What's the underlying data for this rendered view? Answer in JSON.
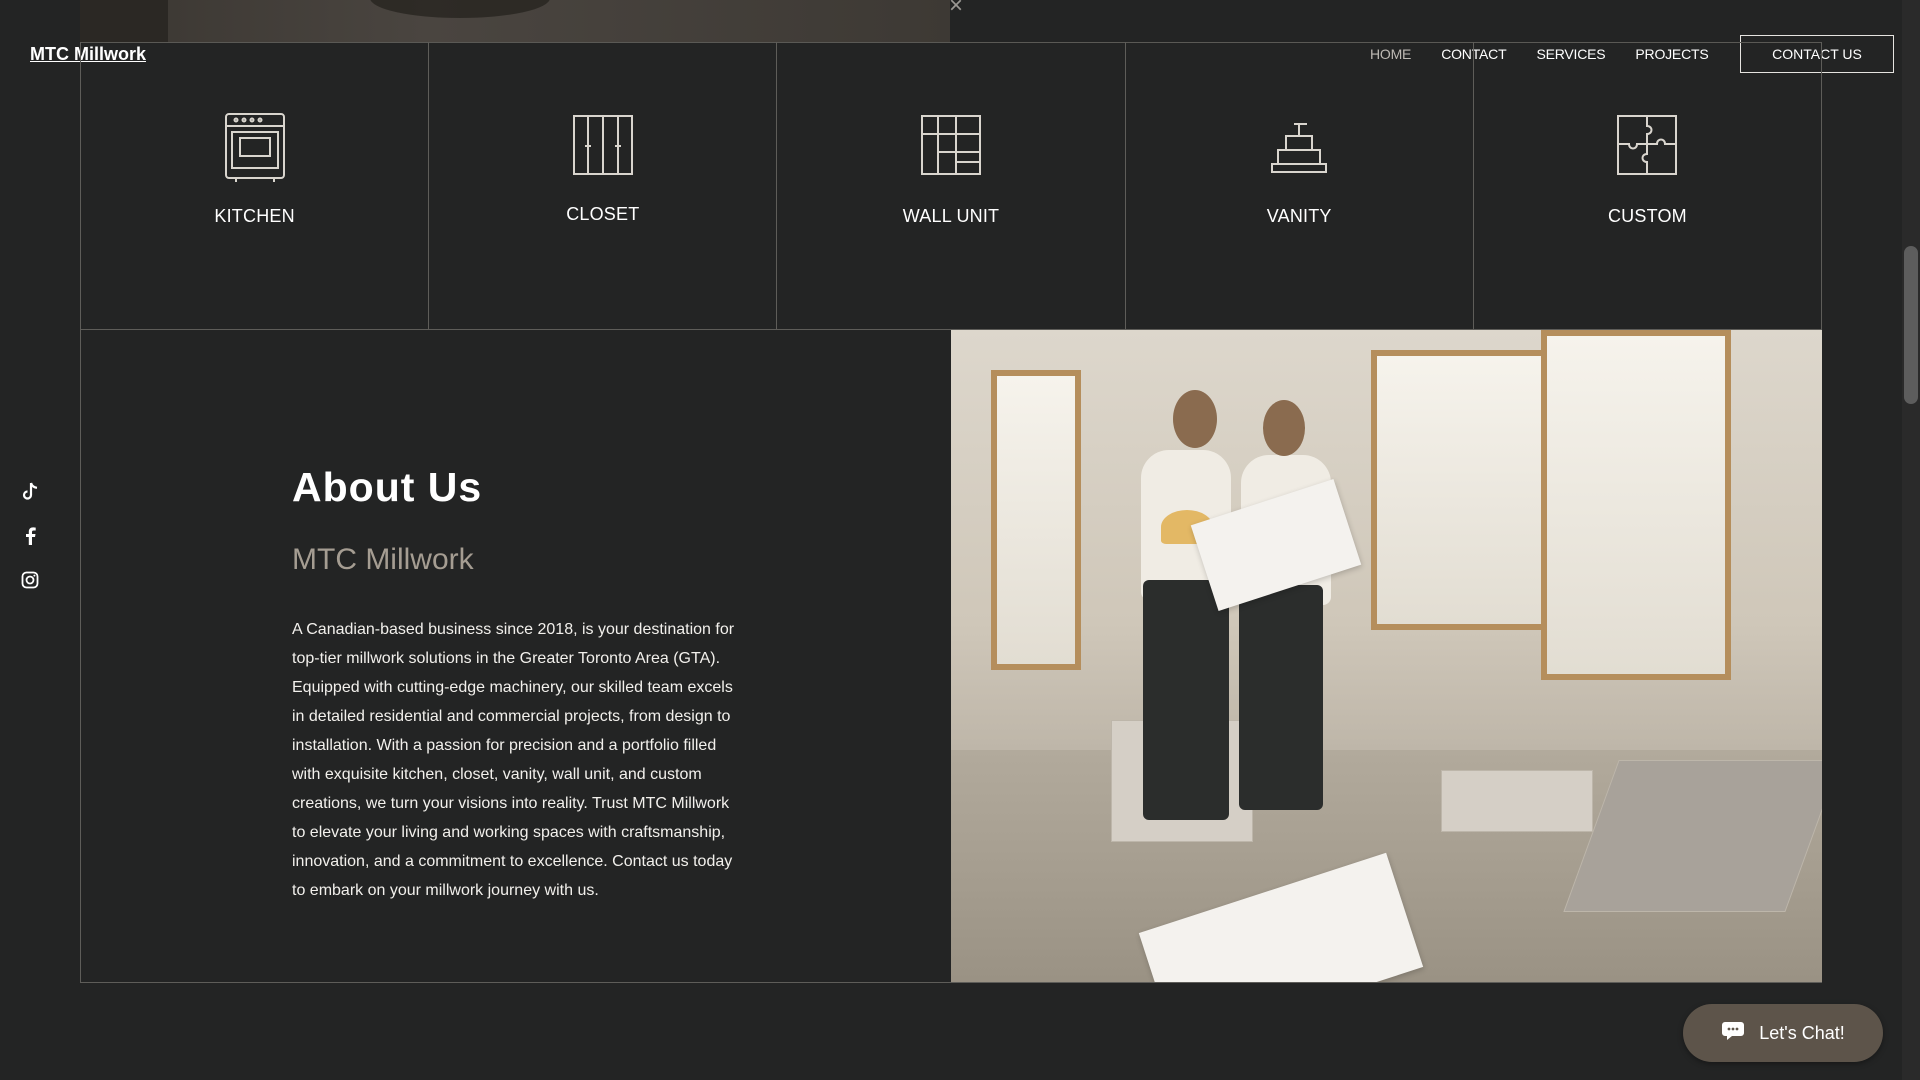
{
  "header": {
    "logo": "MTC Millwork",
    "nav": [
      "HOME",
      "CONTACT",
      "SERVICES",
      "PROJECTS"
    ],
    "cta": "CONTACT US"
  },
  "social": [
    "tiktok-icon",
    "facebook-icon",
    "instagram-icon"
  ],
  "services": [
    {
      "label": "KITCHEN",
      "icon": "oven-icon"
    },
    {
      "label": "CLOSET",
      "icon": "closet-icon"
    },
    {
      "label": "WALL UNIT",
      "icon": "wall-unit-icon"
    },
    {
      "label": "VANITY",
      "icon": "vanity-icon"
    },
    {
      "label": "CUSTOM",
      "icon": "puzzle-icon"
    }
  ],
  "about": {
    "title": "About Us",
    "subtitle": "MTC Millwork",
    "body": "A Canadian-based business since 2018, is your destination for top-tier millwork solutions in the Greater Toronto Area (GTA). Equipped with cutting-edge machinery, our skilled team excels in detailed residential and commercial projects, from design to installation. With a passion for precision and a portfolio filled with exquisite kitchen, closet, vanity, wall unit, and custom creations, we turn your visions into reality. Trust MTC Millwork to elevate your living and working spaces with craftsmanship, innovation, and a commitment to excellence. Contact us today to embark on your millwork journey with us."
  },
  "chat": {
    "label": "Let's Chat!"
  },
  "colors": {
    "background": "#232424",
    "chat": "#5d544a",
    "subtitle": "#a59d92"
  }
}
